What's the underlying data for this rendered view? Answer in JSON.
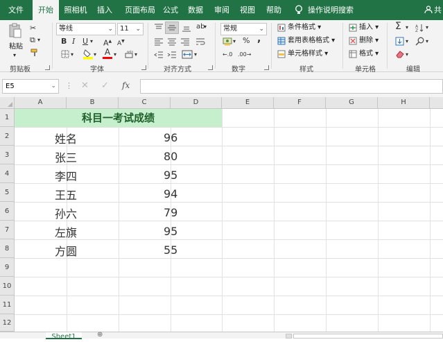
{
  "tabs": [
    {
      "label": "文件"
    },
    {
      "label": "开始"
    },
    {
      "label": "照相机"
    },
    {
      "label": "插入"
    },
    {
      "label": "页面布局"
    },
    {
      "label": "公式"
    },
    {
      "label": "数据"
    },
    {
      "label": "审阅"
    },
    {
      "label": "视图"
    },
    {
      "label": "帮助"
    },
    {
      "label": "操作说明搜索"
    },
    {
      "label": "共"
    }
  ],
  "ribbon": {
    "clipboard": {
      "paste": "粘贴",
      "group": "剪贴板"
    },
    "font": {
      "name": "等线",
      "size": "11",
      "bold": "B",
      "italic": "I",
      "underline": "U",
      "group": "字体"
    },
    "alignment": {
      "group": "对齐方式"
    },
    "number": {
      "format": "常规",
      "percent": "%",
      "comma": ",",
      "group": "数字"
    },
    "styles": {
      "conditional": "条件格式",
      "table": "套用表格格式",
      "cell": "单元格样式",
      "group": "样式"
    },
    "cells": {
      "insert": "插入",
      "delete": "删除",
      "format": "格式",
      "group": "单元格"
    },
    "editing": {
      "sum": "Σ",
      "group": "编辑"
    }
  },
  "formula_bar": {
    "name_box": "E5",
    "fx": "fx",
    "value": ""
  },
  "columns": [
    "A",
    "B",
    "C",
    "D",
    "E",
    "F",
    "G",
    "H"
  ],
  "rows": [
    "1",
    "2",
    "3",
    "4",
    "5",
    "6",
    "7",
    "8",
    "9",
    "10",
    "11",
    "12"
  ],
  "sheet": {
    "title": "科目一考试成绩",
    "records": [
      {
        "name": "姓名",
        "score": "96"
      },
      {
        "name": "张三",
        "score": "80"
      },
      {
        "name": "李四",
        "score": "95"
      },
      {
        "name": "王五",
        "score": "94"
      },
      {
        "name": "孙六",
        "score": "79"
      },
      {
        "name": "左旗",
        "score": "95"
      },
      {
        "name": "方圆",
        "score": "55"
      }
    ]
  },
  "sheet_tabs": [
    {
      "label": "Sheet1"
    }
  ],
  "colors": {
    "accent": "#217346",
    "title_fill": "#c6efce",
    "title_text": "#1f5f2a"
  }
}
